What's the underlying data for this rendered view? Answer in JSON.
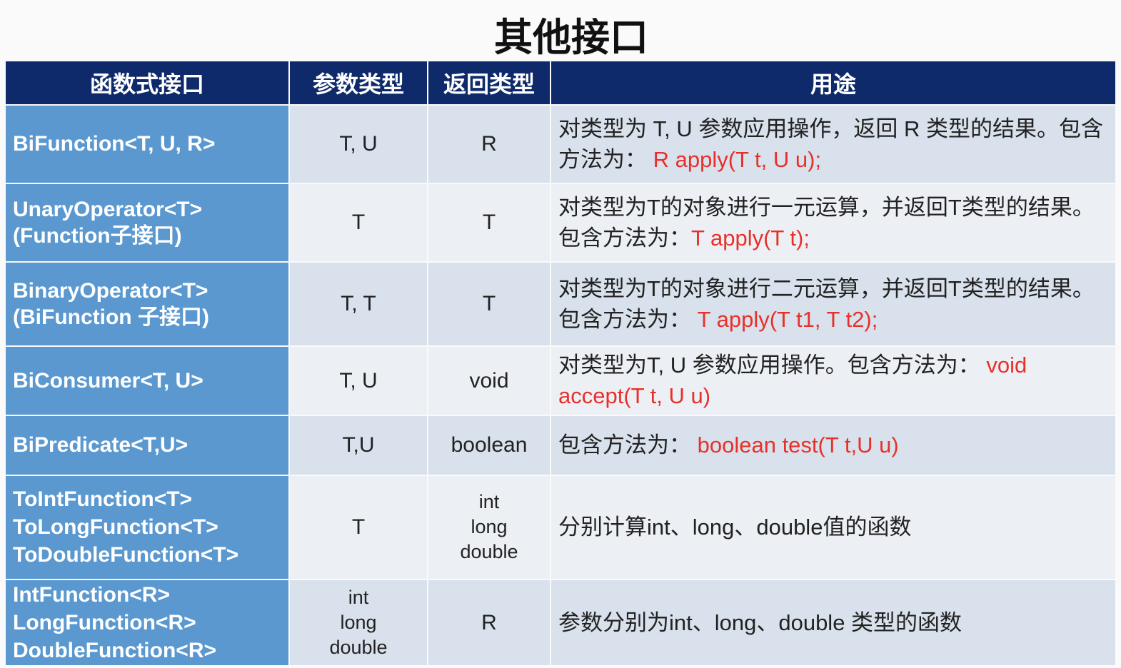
{
  "title": "其他接口",
  "headers": [
    "函数式接口",
    "参数类型",
    "返回类型",
    "用途"
  ],
  "rows": [
    {
      "name": [
        "BiFunction<T, U, R>"
      ],
      "params": [
        "T, U"
      ],
      "ret": [
        "R"
      ],
      "desc_text": "对类型为 T, U 参数应用操作，返回 R 类型的结果。包含方法为： ",
      "desc_code": "R apply(T t, U u);"
    },
    {
      "name": [
        "UnaryOperator<T>",
        "(Function子接口)"
      ],
      "params": [
        "T"
      ],
      "ret": [
        "T"
      ],
      "desc_text": "对类型为T的对象进行一元运算，并返回T类型的结果。包含方法为：",
      "desc_code": "T apply(T t);"
    },
    {
      "name": [
        "BinaryOperator<T>",
        "(BiFunction 子接口)"
      ],
      "params": [
        "T, T"
      ],
      "ret": [
        "T"
      ],
      "desc_text": "对类型为T的对象进行二元运算，并返回T类型的结果。包含方法为：  ",
      "desc_code": "T apply(T t1, T t2);"
    },
    {
      "name": [
        "BiConsumer<T, U>"
      ],
      "params": [
        "T, U"
      ],
      "ret": [
        "void"
      ],
      "desc_text": "对类型为T, U 参数应用操作。包含方法为：  ",
      "desc_code": "void accept(T t, U u)"
    },
    {
      "name": [
        "BiPredicate<T,U>"
      ],
      "params": [
        "T,U"
      ],
      "ret": [
        "boolean"
      ],
      "desc_text": "包含方法为：  ",
      "desc_code": "boolean test(T t,U u)"
    },
    {
      "name": [
        "ToIntFunction<T>",
        "ToLongFunction<T>",
        "ToDoubleFunction<T>"
      ],
      "params": [
        "T"
      ],
      "ret": [
        "int",
        "long",
        "double"
      ],
      "desc_text": "分别计算int、long、double值的函数",
      "desc_code": ""
    },
    {
      "name": [
        "IntFunction<R>",
        "LongFunction<R>",
        "DoubleFunction<R>"
      ],
      "params": [
        "int",
        "long",
        "double"
      ],
      "ret": [
        "R"
      ],
      "desc_text": "参数分别为int、long、double 类型的函数",
      "desc_code": ""
    }
  ]
}
